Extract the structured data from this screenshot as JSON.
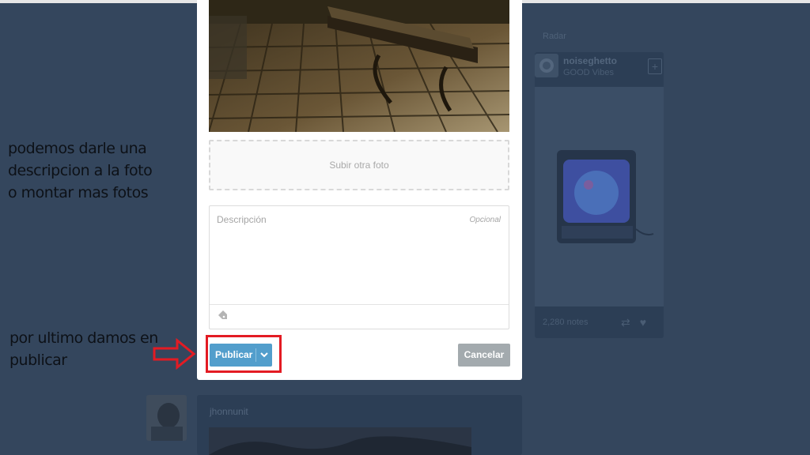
{
  "dashboard": {
    "side_heading": "",
    "side_label": "Radar",
    "recommended": {
      "username": "noiseghetto",
      "subtitle": "GOOD Vibes",
      "notes": "2,280 notes"
    },
    "lower_post": {
      "username": "jhonnunit"
    }
  },
  "post_form": {
    "upload_more": "Subir otra foto",
    "description_placeholder": "Descripción",
    "optional_label": "Opcional",
    "publish_label": "Publicar",
    "cancel_label": "Cancelar",
    "icons": {
      "tag": "tag-icon",
      "dropdown": "chevron-down-icon"
    }
  },
  "annotations": {
    "line1": "podemos darle una",
    "line2": "descripcion a la foto",
    "line3": "o montar mas  fotos",
    "line4": "por ultimo damos en",
    "line5": "publicar"
  },
  "colors": {
    "background": "#34465d",
    "publish": "#529ecc",
    "cancel": "#a3aaae",
    "highlight": "#e31b23"
  }
}
